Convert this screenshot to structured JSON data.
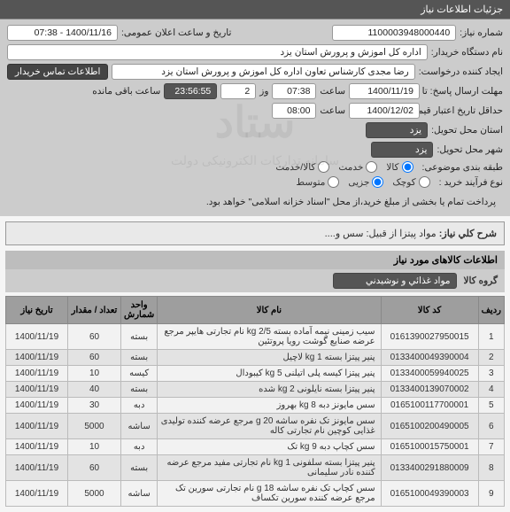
{
  "header_title": "جزئیات اطلاعات نیاز",
  "fields": {
    "need_number_label": "شماره نیاز:",
    "need_number": "1100003948000440",
    "public_datetime_label": "تاریخ و ساعت اعلان عمومی:",
    "public_datetime": "1400/11/16 - 07:38",
    "buyer_label": "نام دستگاه خریدار:",
    "buyer": "اداره کل اموزش و پرورش استان یزد",
    "requester_label": "ایجاد کننده درخواست:",
    "requester": "رضا مجدی کارشناس تعاون اداره کل اموزش و پرورش استان یزد",
    "contact_btn": "اطلاعات تماس خریدار",
    "deadline_label": "مهلت ارسال پاسخ: تا تاریخ:",
    "deadline_date": "1400/11/19",
    "saat_label": "ساعت",
    "deadline_time": "07:38",
    "vaz_label": "وز",
    "vaz_value": "2",
    "remaining_time": "23:56:55",
    "remaining_label": "ساعت باقی مانده",
    "validity_label": "حداقل تاریخ اعتبار قیمت تا تاریخ:",
    "validity_date": "1400/12/02",
    "validity_time": "08:00",
    "province_label": "استان محل تحویل:",
    "province": "یزد",
    "city_label": "شهر محل تحویل:",
    "city": "یزد",
    "topic_class_label": "طبقه بندی موضوعی:",
    "topic_kala": "کالا",
    "topic_khadmat": "خدمت",
    "topic_both": "کالا/خدمت",
    "buy_process_label": "نوع فرآیند خرید :",
    "buy_small": "کوچک",
    "buy_partial": "جزیی",
    "buy_medium": "متوسط",
    "payment_note": "پرداخت تمام یا بخشی از مبلغ خرید،از محل \"اسناد خزانه اسلامی\" خواهد بود."
  },
  "desc": {
    "label": "شرح کلي نياز:",
    "text": "مواد پیتزا از قبیل: سس و...."
  },
  "items_header": "اطلاعات کالاهای مورد نیاز",
  "group": {
    "label": "گروه کالا",
    "value": "مواد غذائي و نوشيدني"
  },
  "columns": {
    "row": "ردیف",
    "code": "کد کالا",
    "name": "نام کالا",
    "unit": "واحد شمارش",
    "qty": "تعداد / مقدار",
    "date": "تاریخ نیاز"
  },
  "rows": [
    {
      "n": "1",
      "code": "0161390027950015",
      "name": "سیب زمینی نیمه آماده بسته 2/5 kg نام تجارتی هایپر مرجع عرضه صنایع گوشت رویا پروتئین",
      "unit": "بسته",
      "qty": "60",
      "date": "1400/11/19"
    },
    {
      "n": "2",
      "code": "0133400049390004",
      "name": "پنیر پیتزا بسته 1 kg لاچیل",
      "unit": "بسته",
      "qty": "60",
      "date": "1400/11/19"
    },
    {
      "n": "3",
      "code": "0133400059940025",
      "name": "پنیر پیتزا کیسه پلی اتیلنی 5 kg کیبودال",
      "unit": "کیسه",
      "qty": "10",
      "date": "1400/11/19"
    },
    {
      "n": "4",
      "code": "0133400139070002",
      "name": "پنیر پیتزا بسته نایلونی 2 kg شده",
      "unit": "بسته",
      "qty": "40",
      "date": "1400/11/19"
    },
    {
      "n": "5",
      "code": "0165100117700001",
      "name": "سس مایونز دبه 8 kg بهروز",
      "unit": "دبه",
      "qty": "30",
      "date": "1400/11/19"
    },
    {
      "n": "6",
      "code": "0165100200490005",
      "name": "سس مایونز تک نفره ساشه 20 g مرجع عرضه کننده تولیدی غذایی کوچین نام تجارتی کاله",
      "unit": "ساشه",
      "qty": "5000",
      "date": "1400/11/19"
    },
    {
      "n": "7",
      "code": "0165100015750001",
      "name": "سس کچاپ دبه 9 kg تک",
      "unit": "دبه",
      "qty": "10",
      "date": "1400/11/19"
    },
    {
      "n": "8",
      "code": "0133400291880009",
      "name": "پنیر پیتزا بسته سلفونی 1 kg نام تجارتی مفید مرجع عرضه کننده نادر سلیمانی",
      "unit": "بسته",
      "qty": "60",
      "date": "1400/11/19"
    },
    {
      "n": "9",
      "code": "0165100049390003",
      "name": "سس کچاپ تک نفره ساشه 18 g نام تجارتی سورین تک مرجع عرضه کننده سورین تکساف",
      "unit": "ساشه",
      "qty": "5000",
      "date": "1400/11/19"
    }
  ],
  "watermark_main": "ستاد",
  "watermark_sub": "سامانه تدارکات الکترونیکی دولت"
}
